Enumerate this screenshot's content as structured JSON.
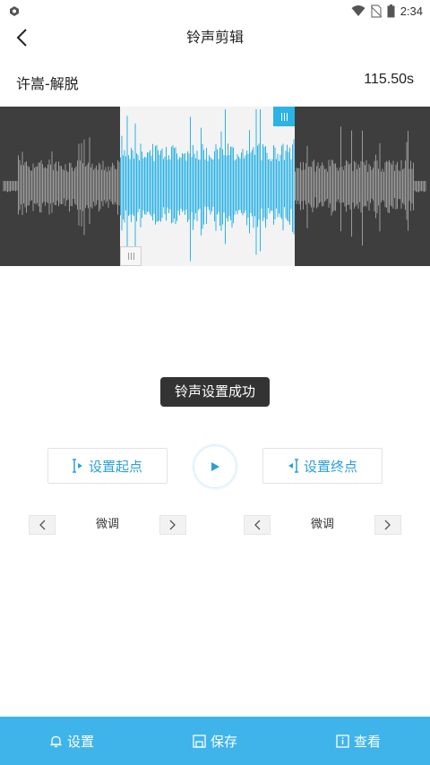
{
  "status_bar": {
    "time": "2:34",
    "icons": [
      "app-icon",
      "wifi-icon",
      "no-sim-icon",
      "battery-icon"
    ]
  },
  "header": {
    "title": "铃声剪辑",
    "back_icon": "chevron-left-icon"
  },
  "song": {
    "name": "许嵩-解脱",
    "duration": "115.50s"
  },
  "waveform": {
    "selected_color": "#2bb3e6",
    "unselected_color": "#9a9a9a",
    "dark_bg": "#3e3e3e"
  },
  "toast": {
    "text": "铃声设置成功"
  },
  "controls": {
    "set_start_label": "设置起点",
    "set_end_label": "设置终点",
    "play_icon": "play-icon"
  },
  "fine_tune": {
    "left_label": "微调",
    "right_label": "微调"
  },
  "bottom_nav": {
    "accent": "#3fb4ea",
    "items": [
      {
        "label": "设置",
        "icon": "bell-icon"
      },
      {
        "label": "保存",
        "icon": "save-icon"
      },
      {
        "label": "查看",
        "icon": "view-icon"
      }
    ]
  }
}
